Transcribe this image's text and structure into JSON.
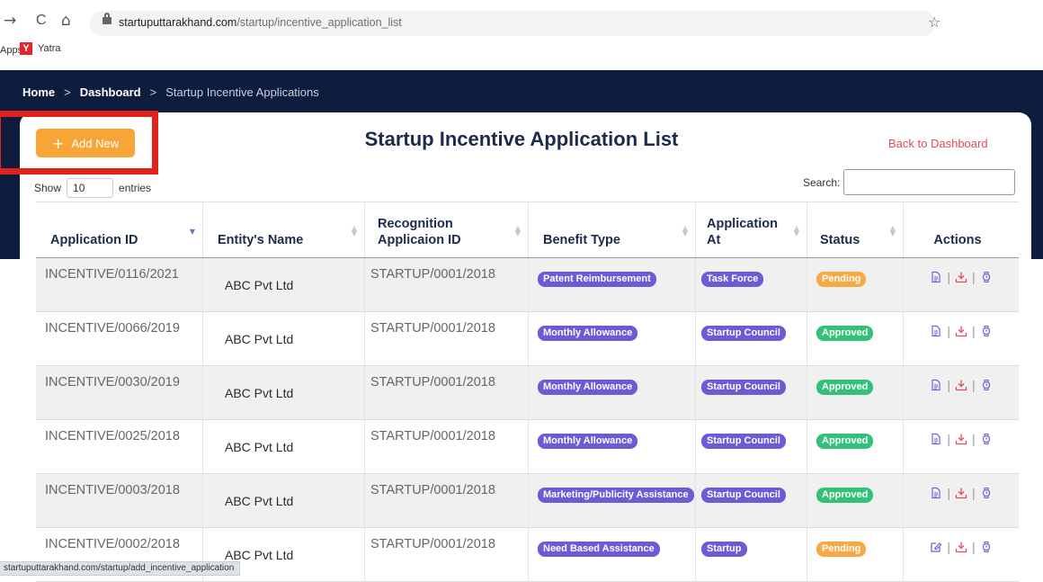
{
  "browser": {
    "url_host": "startuputtarakhand.com",
    "url_path": "/startup/incentive_application_list",
    "bookmarks": [
      {
        "label": "Apps"
      },
      {
        "label": "Yatra",
        "logo_letter": "Y"
      }
    ],
    "nav_icons": {
      "forward": "→",
      "reload": "C",
      "home": "⌂",
      "star": "☆"
    },
    "status_url": "startuputtarakhand.com/startup/add_incentive_application"
  },
  "breadcrumb": {
    "home": "Home",
    "separator": ">",
    "dashboard": "Dashboard",
    "current": "Startup Incentive Applications"
  },
  "page": {
    "title": "Startup Incentive Application List",
    "add_new": "Add New",
    "add_icon": "+",
    "back_link": "Back to Dashboard",
    "show_label": "Show",
    "show_value": "10",
    "entries_label": "entries",
    "search_label": "Search:"
  },
  "table": {
    "columns": [
      "Application ID",
      "Entity's Name",
      "Recognition Applicaion ID",
      "Benefit Type",
      "Application At",
      "Status",
      "Actions"
    ],
    "rows": [
      {
        "id": "INCENTIVE/0116/2021",
        "entity": "ABC Pvt Ltd",
        "recognition": "STARTUP/0001/2018",
        "benefit": "Patent Reimbursement",
        "at": "Task Force",
        "status": "Pending",
        "first_action": "document-icon"
      },
      {
        "id": "INCENTIVE/0066/2019",
        "entity": "ABC Pvt Ltd",
        "recognition": "STARTUP/0001/2018",
        "benefit": "Monthly Allowance",
        "at": "Startup Council",
        "status": "Approved",
        "first_action": "document-icon"
      },
      {
        "id": "INCENTIVE/0030/2019",
        "entity": "ABC Pvt Ltd",
        "recognition": "STARTUP/0001/2018",
        "benefit": "Monthly Allowance",
        "at": "Startup Council",
        "status": "Approved",
        "first_action": "document-icon"
      },
      {
        "id": "INCENTIVE/0025/2018",
        "entity": "ABC Pvt Ltd",
        "recognition": "STARTUP/0001/2018",
        "benefit": "Monthly Allowance",
        "at": "Startup Council",
        "status": "Approved",
        "first_action": "document-icon"
      },
      {
        "id": "INCENTIVE/0003/2018",
        "entity": "ABC Pvt Ltd",
        "recognition": "STARTUP/0001/2018",
        "benefit": "Marketing/Publicity Assistance",
        "at": "Startup Council",
        "status": "Approved",
        "first_action": "document-icon"
      },
      {
        "id": "INCENTIVE/0002/2018",
        "entity": "ABC Pvt Ltd",
        "recognition": "STARTUP/0001/2018",
        "benefit": "Need Based Assistance",
        "at": "Startup",
        "status": "Pending",
        "first_action": "edit-icon"
      }
    ]
  },
  "colors": {
    "header_bg": "#0e1c3d",
    "add_button": "#f7a536",
    "highlight": "#e0231b",
    "link": "#e44a5d",
    "badge_purple": "#6b5bd6",
    "badge_pending": "#f7a944",
    "badge_approved": "#33c17a",
    "icon_doc": "#7b5cd6",
    "icon_download": "#e44a5d"
  }
}
